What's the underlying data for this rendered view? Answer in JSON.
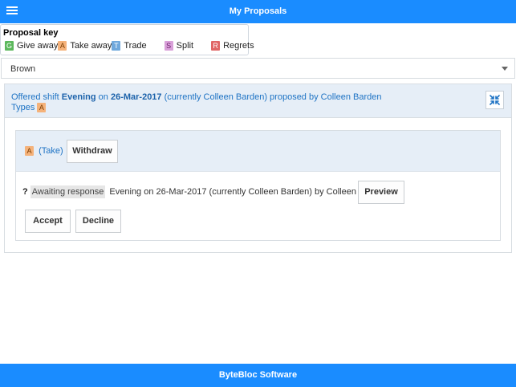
{
  "header": {
    "title": "My Proposals",
    "menu_icon": "hamburger-menu-icon"
  },
  "key": {
    "title": "Proposal key",
    "items": [
      {
        "letter": "G",
        "label": "Give away",
        "bg": "#5cb85c",
        "fg": "#ffffff"
      },
      {
        "letter": "A",
        "label": "Take away",
        "bg": "#f5b27a",
        "fg": "#7a3c00"
      },
      {
        "letter": "T",
        "label": "Trade",
        "bg": "#6fa8dc",
        "fg": "#ffffff"
      },
      {
        "letter": "S",
        "label": "Split",
        "bg": "#d9a0d9",
        "fg": "#6a1a6a"
      },
      {
        "letter": "R",
        "label": "Regrets",
        "bg": "#e06666",
        "fg": "#ffffff"
      }
    ]
  },
  "filter": {
    "selected": "Brown"
  },
  "proposal": {
    "prefix": "Offered shift",
    "shift": "Evening",
    "on": "on",
    "date": "26-Mar-2017",
    "suffix": "(currently Colleen Barden) proposed by Colleen Barden",
    "types_label": "Types",
    "type_letter": "A",
    "collapse_icon": "collapse-arrows-icon",
    "response": {
      "tag_letter": "A",
      "tag_label": "(Take)",
      "withdraw_label": "Withdraw",
      "question_mark": "?",
      "status": "Awaiting response",
      "description": "Evening on 26-Mar-2017 (currently Colleen Barden) by Colleen Barden",
      "preview_label": "Preview",
      "accept_label": "Accept",
      "decline_label": "Decline"
    }
  },
  "footer": {
    "text": "ByteBloc Software"
  },
  "colors": {
    "primary": "#1a8cff",
    "panel": "#e6eef7",
    "link": "#1e73c4"
  }
}
